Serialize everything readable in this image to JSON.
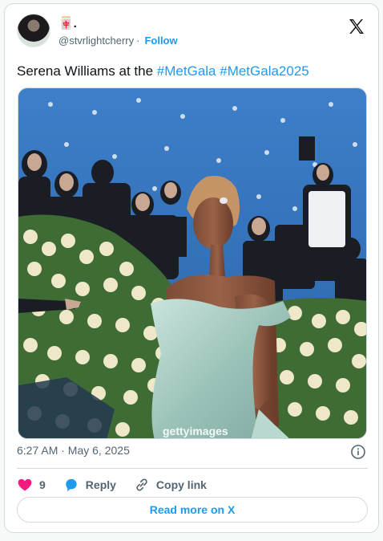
{
  "author": {
    "display_name": "🀄.",
    "handle": "@stvrlightcherry",
    "follow_label": "Follow"
  },
  "tweet": {
    "text_prefix": "Serena Williams at the ",
    "hashtags": [
      "#MetGala",
      "#MetGala2025"
    ]
  },
  "media": {
    "watermark": "gettyimages",
    "alt": "Serena Williams in a pale mint satin off-shoulder gown at the Met Gala, photographers in background"
  },
  "meta": {
    "timestamp": "6:27 AM · May 6, 2025"
  },
  "actions": {
    "likes_count": "9",
    "reply_label": "Reply",
    "copy_label": "Copy link"
  },
  "read_more_label": "Read more on X",
  "colors": {
    "accent": "#1d9bf0",
    "like": "#f91880",
    "text": "#0f1419",
    "secondary": "#536471"
  },
  "icons": [
    "x-logo-icon",
    "info-icon",
    "heart-icon",
    "reply-bubble-icon",
    "link-icon"
  ]
}
